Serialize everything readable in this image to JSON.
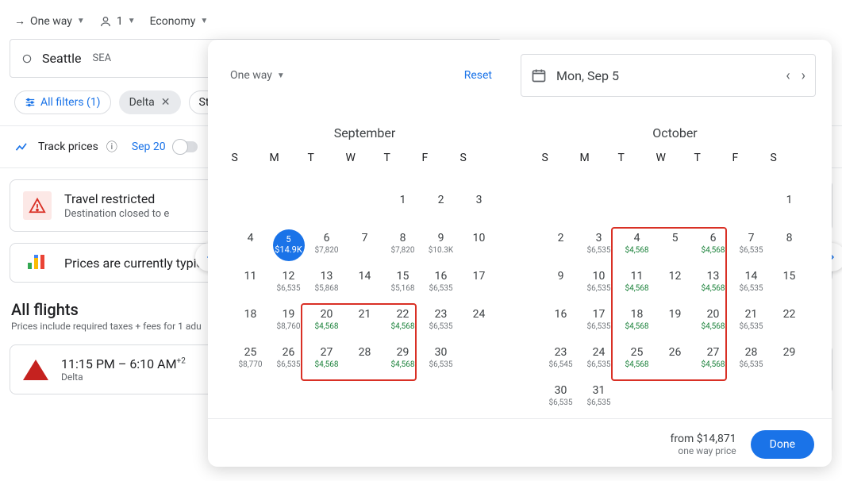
{
  "top": {
    "trip_type": "One way",
    "passengers": "1",
    "cabin": "Economy"
  },
  "origin": {
    "city": "Seattle",
    "code": "SEA"
  },
  "filters": {
    "all_label": "All filters (1)",
    "delta_label": "Delta",
    "stops_label": "St"
  },
  "track": {
    "label": "Track prices",
    "date": "Sep 20"
  },
  "restrict": {
    "title": "Travel restricted",
    "sub": "Destination closed to e"
  },
  "typical": {
    "text": "Prices are currently typic"
  },
  "all_flights": {
    "heading": "All flights",
    "sub": "Prices include required taxes + fees for 1 adu"
  },
  "flight": {
    "time": "11:15 PM – 6:10 AM",
    "plus": "+2",
    "airline": "Delta"
  },
  "panel": {
    "trip_label": "One way",
    "reset": "Reset",
    "date_value": "Mon, Sep 5",
    "footer_from": "from $14,871",
    "footer_sub": "one way price",
    "done": "Done"
  },
  "dow": [
    "S",
    "M",
    "T",
    "W",
    "T",
    "F",
    "S"
  ],
  "months": [
    {
      "name": "September",
      "offset": 4,
      "days": [
        {
          "d": 1
        },
        {
          "d": 2
        },
        {
          "d": 3
        },
        {
          "d": 4
        },
        {
          "d": 5,
          "p": "$14.9K",
          "sel": true
        },
        {
          "d": 6,
          "p": "$7,820"
        },
        {
          "d": 7
        },
        {
          "d": 8,
          "p": "$7,820"
        },
        {
          "d": 9,
          "p": "$10.3K"
        },
        {
          "d": 10
        },
        {
          "d": 11
        },
        {
          "d": 12,
          "p": "$6,535"
        },
        {
          "d": 13,
          "p": "$5,868"
        },
        {
          "d": 14
        },
        {
          "d": 15,
          "p": "$5,168"
        },
        {
          "d": 16,
          "p": "$6,535"
        },
        {
          "d": 17
        },
        {
          "d": 18
        },
        {
          "d": 19,
          "p": "$8,760"
        },
        {
          "d": 20,
          "p": "$4,568",
          "low": true
        },
        {
          "d": 21
        },
        {
          "d": 22,
          "p": "$4,568",
          "low": true
        },
        {
          "d": 23,
          "p": "$6,535"
        },
        {
          "d": 24
        },
        {
          "d": 25,
          "p": "$8,770"
        },
        {
          "d": 26,
          "p": "$6,535"
        },
        {
          "d": 27,
          "p": "$4,568",
          "low": true
        },
        {
          "d": 28
        },
        {
          "d": 29,
          "p": "$4,568",
          "low": true
        },
        {
          "d": 30,
          "p": "$6,535"
        }
      ],
      "highlights": [
        {
          "row_start": 4,
          "col_start": 2,
          "row_span": 2,
          "col_span": 3
        }
      ]
    },
    {
      "name": "October",
      "offset": 6,
      "days": [
        {
          "d": 1
        },
        {
          "d": 2
        },
        {
          "d": 3,
          "p": "$6,535"
        },
        {
          "d": 4,
          "p": "$4,568",
          "low": true
        },
        {
          "d": 5
        },
        {
          "d": 6,
          "p": "$4,568",
          "low": true
        },
        {
          "d": 7,
          "p": "$6,535"
        },
        {
          "d": 8
        },
        {
          "d": 9
        },
        {
          "d": 10,
          "p": "$6,535"
        },
        {
          "d": 11,
          "p": "$4,568",
          "low": true
        },
        {
          "d": 12
        },
        {
          "d": 13,
          "p": "$4,568",
          "low": true
        },
        {
          "d": 14,
          "p": "$6,535"
        },
        {
          "d": 15
        },
        {
          "d": 16
        },
        {
          "d": 17,
          "p": "$6,535"
        },
        {
          "d": 18,
          "p": "$4,568",
          "low": true
        },
        {
          "d": 19
        },
        {
          "d": 20,
          "p": "$4,568",
          "low": true
        },
        {
          "d": 21,
          "p": "$6,535"
        },
        {
          "d": 22
        },
        {
          "d": 23,
          "p": "$6,545"
        },
        {
          "d": 24,
          "p": "$6,535"
        },
        {
          "d": 25,
          "p": "$4,568",
          "low": true
        },
        {
          "d": 26
        },
        {
          "d": 27,
          "p": "$4,568",
          "low": true
        },
        {
          "d": 28,
          "p": "$6,535"
        },
        {
          "d": 29
        },
        {
          "d": 30,
          "p": "$6,535"
        },
        {
          "d": 31,
          "p": "$6,535"
        }
      ],
      "highlights": [
        {
          "row_start": 2,
          "col_start": 2,
          "row_span": 4,
          "col_span": 3
        }
      ]
    }
  ]
}
